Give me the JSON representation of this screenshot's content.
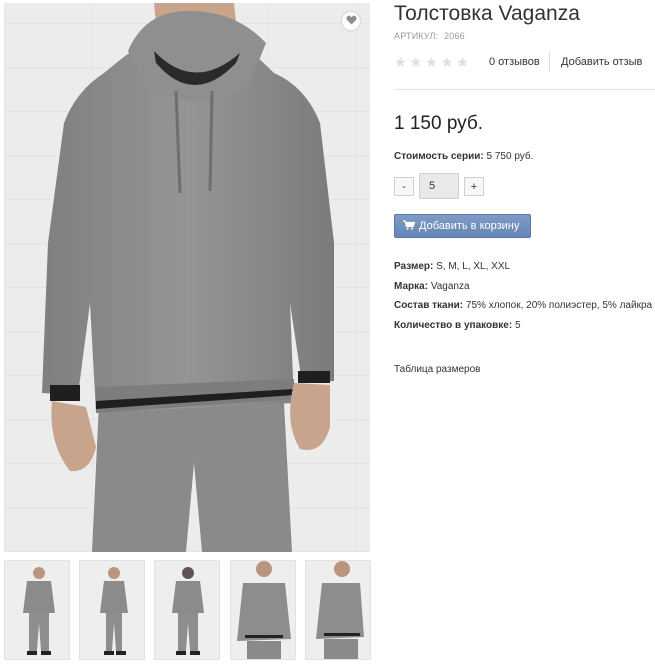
{
  "product": {
    "title": "Толстовка Vaganza",
    "sku_label": "АРТИКУЛ:",
    "sku_value": "2066",
    "reviews_count_text": "0 отзывов",
    "add_review": "Добавить отзыв",
    "rating_stars": 5,
    "rating_value": 0,
    "price": "1 150 руб.",
    "series_price_label": "Стоимость серии:",
    "series_price_value": "5 750 руб.",
    "quantity": {
      "minus": "-",
      "value": "5",
      "plus": "+"
    },
    "add_to_cart": "Добавить в корзину",
    "specs": [
      {
        "label": "Размер:",
        "value": "S, M, L, XL, XXL"
      },
      {
        "label": "Марка:",
        "value": "Vaganza"
      },
      {
        "label": "Состав ткани:",
        "value": "75% хлопок, 20% полиэстер, 5% лайкра"
      },
      {
        "label": "Количество в упаковке:",
        "value": "5"
      }
    ],
    "size_table_link": "Таблица размеров"
  },
  "gallery": {
    "main_image": "gray-hoodie-model-front",
    "thumbnails": [
      "model-front-full",
      "model-side-full",
      "model-back-full",
      "model-front-close",
      "model-side-close"
    ]
  },
  "icons": {
    "favorite": "heart-icon",
    "cart": "cart-icon",
    "star": "star-icon"
  },
  "colors": {
    "button": "#6f8fbd",
    "hoodie": "#8d8d8d",
    "star_empty": "#dedede"
  }
}
